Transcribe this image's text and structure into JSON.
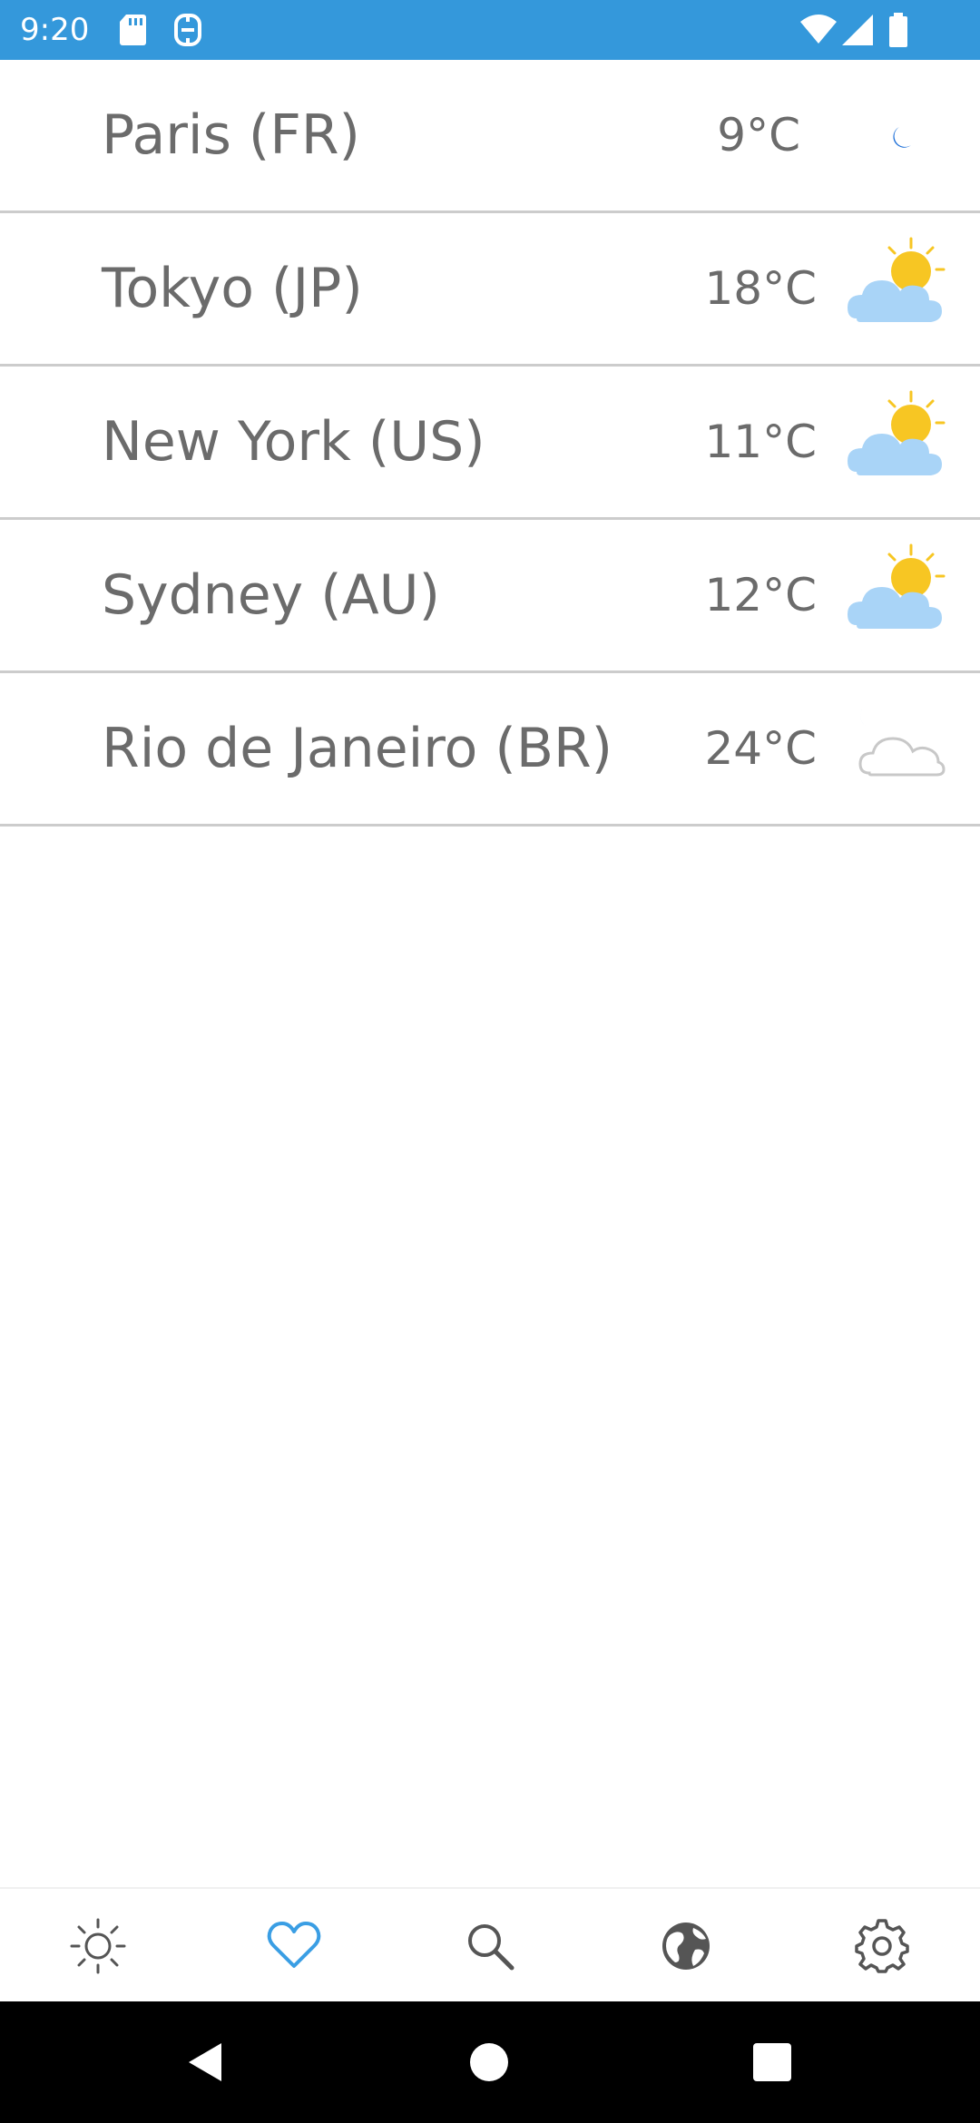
{
  "status_bar": {
    "time": "9:20",
    "background": "#3498db",
    "icons": [
      "sd-card-icon",
      "nfc-icon",
      "wifi-icon",
      "signal-icon",
      "battery-icon"
    ]
  },
  "cities": [
    {
      "name": "Paris (FR)",
      "temp": "9°C",
      "icon": "moon-icon"
    },
    {
      "name": "Tokyo (JP)",
      "temp": "18°C",
      "icon": "sun-behind-cloud-icon"
    },
    {
      "name": "New York (US)",
      "temp": "11°C",
      "icon": "sun-behind-cloud-icon"
    },
    {
      "name": "Sydney (AU)",
      "temp": "12°C",
      "icon": "sun-behind-cloud-icon"
    },
    {
      "name": "Rio de Janeiro (BR)",
      "temp": "24°C",
      "icon": "moon-cloud-icon"
    }
  ],
  "bottom_nav": {
    "items": [
      {
        "id": "weather",
        "icon": "sun-outline-icon",
        "active": false
      },
      {
        "id": "favorites",
        "icon": "heart-icon",
        "active": true
      },
      {
        "id": "search",
        "icon": "search-icon",
        "active": false
      },
      {
        "id": "globe",
        "icon": "globe-icon",
        "active": false
      },
      {
        "id": "settings",
        "icon": "gear-icon",
        "active": false
      }
    ],
    "active_color": "#3a9ee4",
    "inactive_color": "#555555"
  },
  "colors": {
    "moon": "#1b6ed8",
    "sun": "#f7c623",
    "cloud": "#a9d4f7",
    "divider": "#cccccc",
    "text": "#6b6b6b"
  }
}
